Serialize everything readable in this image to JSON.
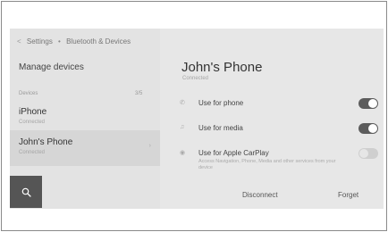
{
  "breadcrumb": {
    "settings": "Settings",
    "separator": "•",
    "current": "Bluetooth & Devices"
  },
  "sidebar": {
    "title": "Manage devices",
    "section_label": "Devices",
    "device_count": "3/5",
    "devices": [
      {
        "name": "iPhone",
        "status": "Connected",
        "selected": false
      },
      {
        "name": "John's Phone",
        "status": "Connected",
        "selected": true
      }
    ]
  },
  "detail": {
    "title": "John's Phone",
    "status": "Connected",
    "options": [
      {
        "label": "Use for phone",
        "icon": "phone-icon",
        "enabled": true
      },
      {
        "label": "Use for media",
        "icon": "music-note-icon",
        "enabled": true
      },
      {
        "label": "Use for Apple CarPlay",
        "icon": "carplay-icon",
        "enabled": false,
        "description": "Access Navigation, Phone, Media and other services from your device"
      }
    ],
    "actions": {
      "disconnect": "Disconnect",
      "forget": "Forget"
    }
  },
  "colors": {
    "toggle_on": "#5c5c5c",
    "toggle_off": "#cfcfcf",
    "search_button": "#555555"
  }
}
